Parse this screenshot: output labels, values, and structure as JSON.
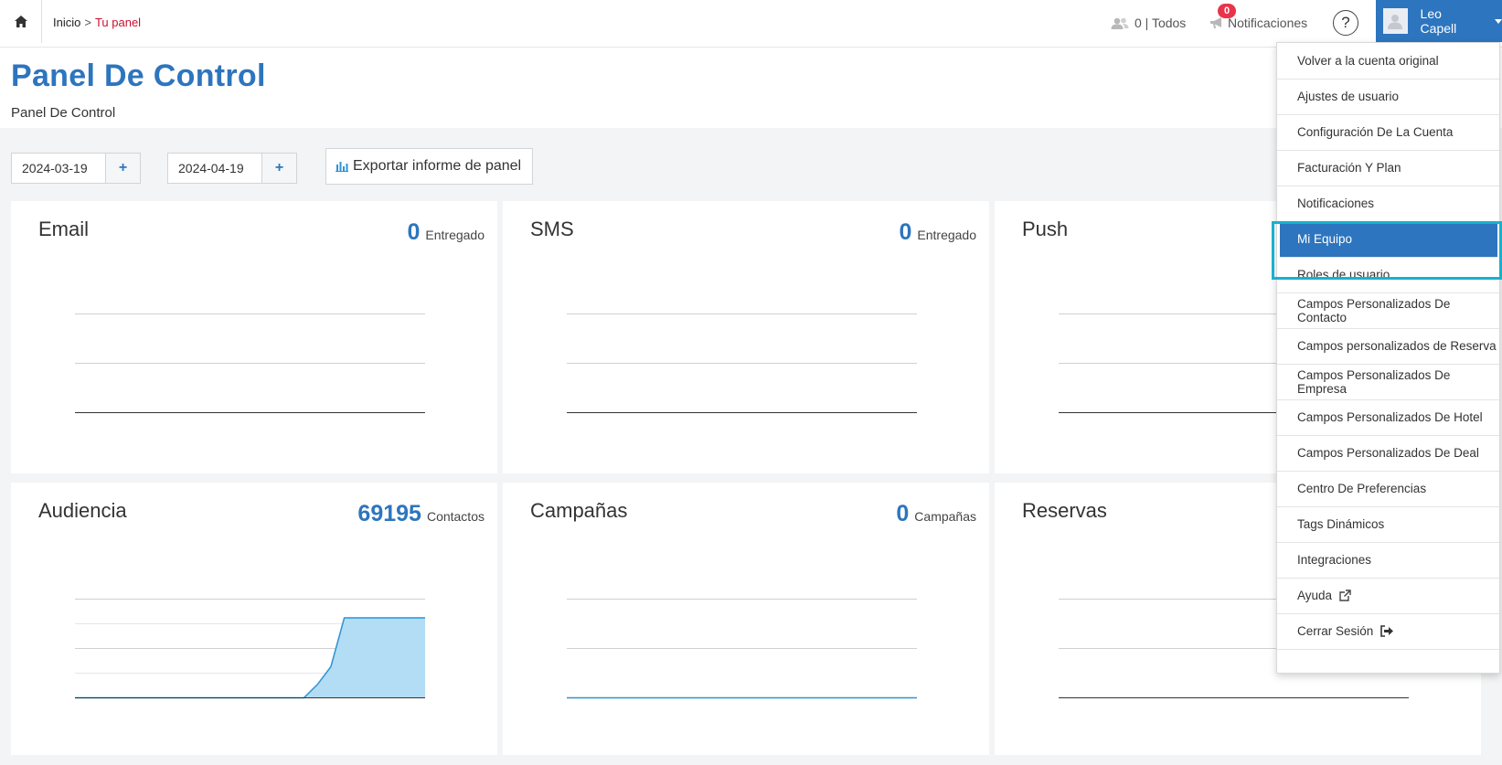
{
  "breadcrumb": {
    "home": "Inicio",
    "separator": ">",
    "current": "Tu panel"
  },
  "header": {
    "team_count": "0 | Todos",
    "notifications_label": "Notificaciones",
    "notifications_badge": "0",
    "help_label": "?",
    "user_name": "Leo Capell"
  },
  "page": {
    "title": "Panel De Control",
    "subtitle": "Panel De Control"
  },
  "filters": {
    "start_date": "2024-03-19",
    "end_date": "2024-04-19",
    "plus": "+",
    "export_label": "Exportar informe de panel"
  },
  "cards": [
    {
      "title": "Email",
      "value": "0",
      "unit": "Entregado"
    },
    {
      "title": "SMS",
      "value": "0",
      "unit": "Entregado"
    },
    {
      "title": "Push",
      "value": "",
      "unit": ""
    },
    {
      "title": "Audiencia",
      "value": "69195",
      "unit": "Contactos"
    },
    {
      "title": "Campañas",
      "value": "0",
      "unit": "Campañas"
    },
    {
      "title": "Reservas",
      "value": "",
      "unit": ""
    }
  ],
  "audiencia_chart": {
    "type": "area",
    "values": [
      0,
      0,
      0,
      0,
      0,
      0,
      0,
      0,
      0,
      0,
      0,
      0,
      0,
      0,
      0,
      0,
      0,
      0,
      0.15,
      0.35,
      0.9,
      0.9,
      0.9,
      0.9,
      0.9,
      0.9,
      0.9
    ],
    "color": "#b3dcf5",
    "line_color": "#2b94d6"
  },
  "menu": {
    "items": [
      "Volver a la cuenta original",
      "Ajustes de usuario",
      "Configuración De La Cuenta",
      "Facturación Y Plan",
      "Notificaciones",
      "Mi Equipo",
      "Roles de usuario",
      "Campos Personalizados De Contacto",
      "Campos personalizados de Reserva",
      "Campos Personalizados De Empresa",
      "Campos Personalizados De Hotel",
      "Campos Personalizados De Deal",
      "Centro De Preferencias",
      "Tags Dinámicos",
      "Integraciones",
      "Ayuda",
      "Cerrar Sesión"
    ],
    "active": "Mi Equipo"
  },
  "colors": {
    "brand": "#2d75be",
    "alert": "#e8334a",
    "highlight": "#19b0cf"
  }
}
